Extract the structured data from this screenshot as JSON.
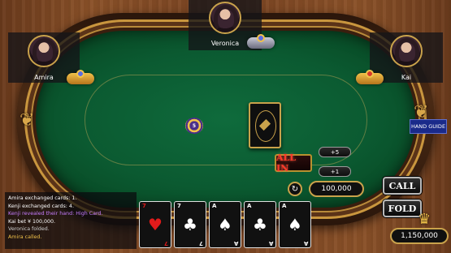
{
  "players": {
    "top": {
      "name": "Veronica"
    },
    "left": {
      "name": "Amira"
    },
    "right": {
      "name": "Kai"
    }
  },
  "table": {
    "pot_chip": "5",
    "deck": "card-back"
  },
  "controls": {
    "all_in_label": "ALL IN",
    "plus5_label": "+5",
    "plus1_label": "+1",
    "bet_amount": "100,000",
    "refresh_icon": "↻",
    "call_label": "CALL",
    "fold_label": "FOLD",
    "hand_guide_label": "HAND GUIDE",
    "balance": "1,150,000"
  },
  "log": [
    {
      "text": "Amira exchanged cards: 1.",
      "color": "#ffffff"
    },
    {
      "text": "Kenji exchanged cards: 4.",
      "color": "#ffffff"
    },
    {
      "text": "Kenji revealed their hand: High Card.",
      "color": "#c77dff"
    },
    {
      "text": "Kai bet ¥ 100,000.",
      "color": "#ffffff"
    },
    {
      "text": "Veronica folded.",
      "color": "#cfcfcf"
    },
    {
      "text": "Amira called.",
      "color": "#f1c24a"
    }
  ],
  "hand": [
    {
      "rank": "7",
      "suit": "♥",
      "suit_name": "hearts",
      "color": "red"
    },
    {
      "rank": "7",
      "suit": "♣",
      "suit_name": "clubs",
      "color": "white"
    },
    {
      "rank": "A",
      "suit": "♠",
      "suit_name": "spades",
      "color": "white"
    },
    {
      "rank": "A",
      "suit": "♣",
      "suit_name": "clubs",
      "color": "white"
    },
    {
      "rank": "A",
      "suit": "♠",
      "suit_name": "spades",
      "color": "white"
    }
  ],
  "colors": {
    "felt": "#0b5a31",
    "gold": "#c9a24b",
    "all_in_red": "#ff3a2a",
    "hand_guide_blue": "#1a2a8a"
  }
}
